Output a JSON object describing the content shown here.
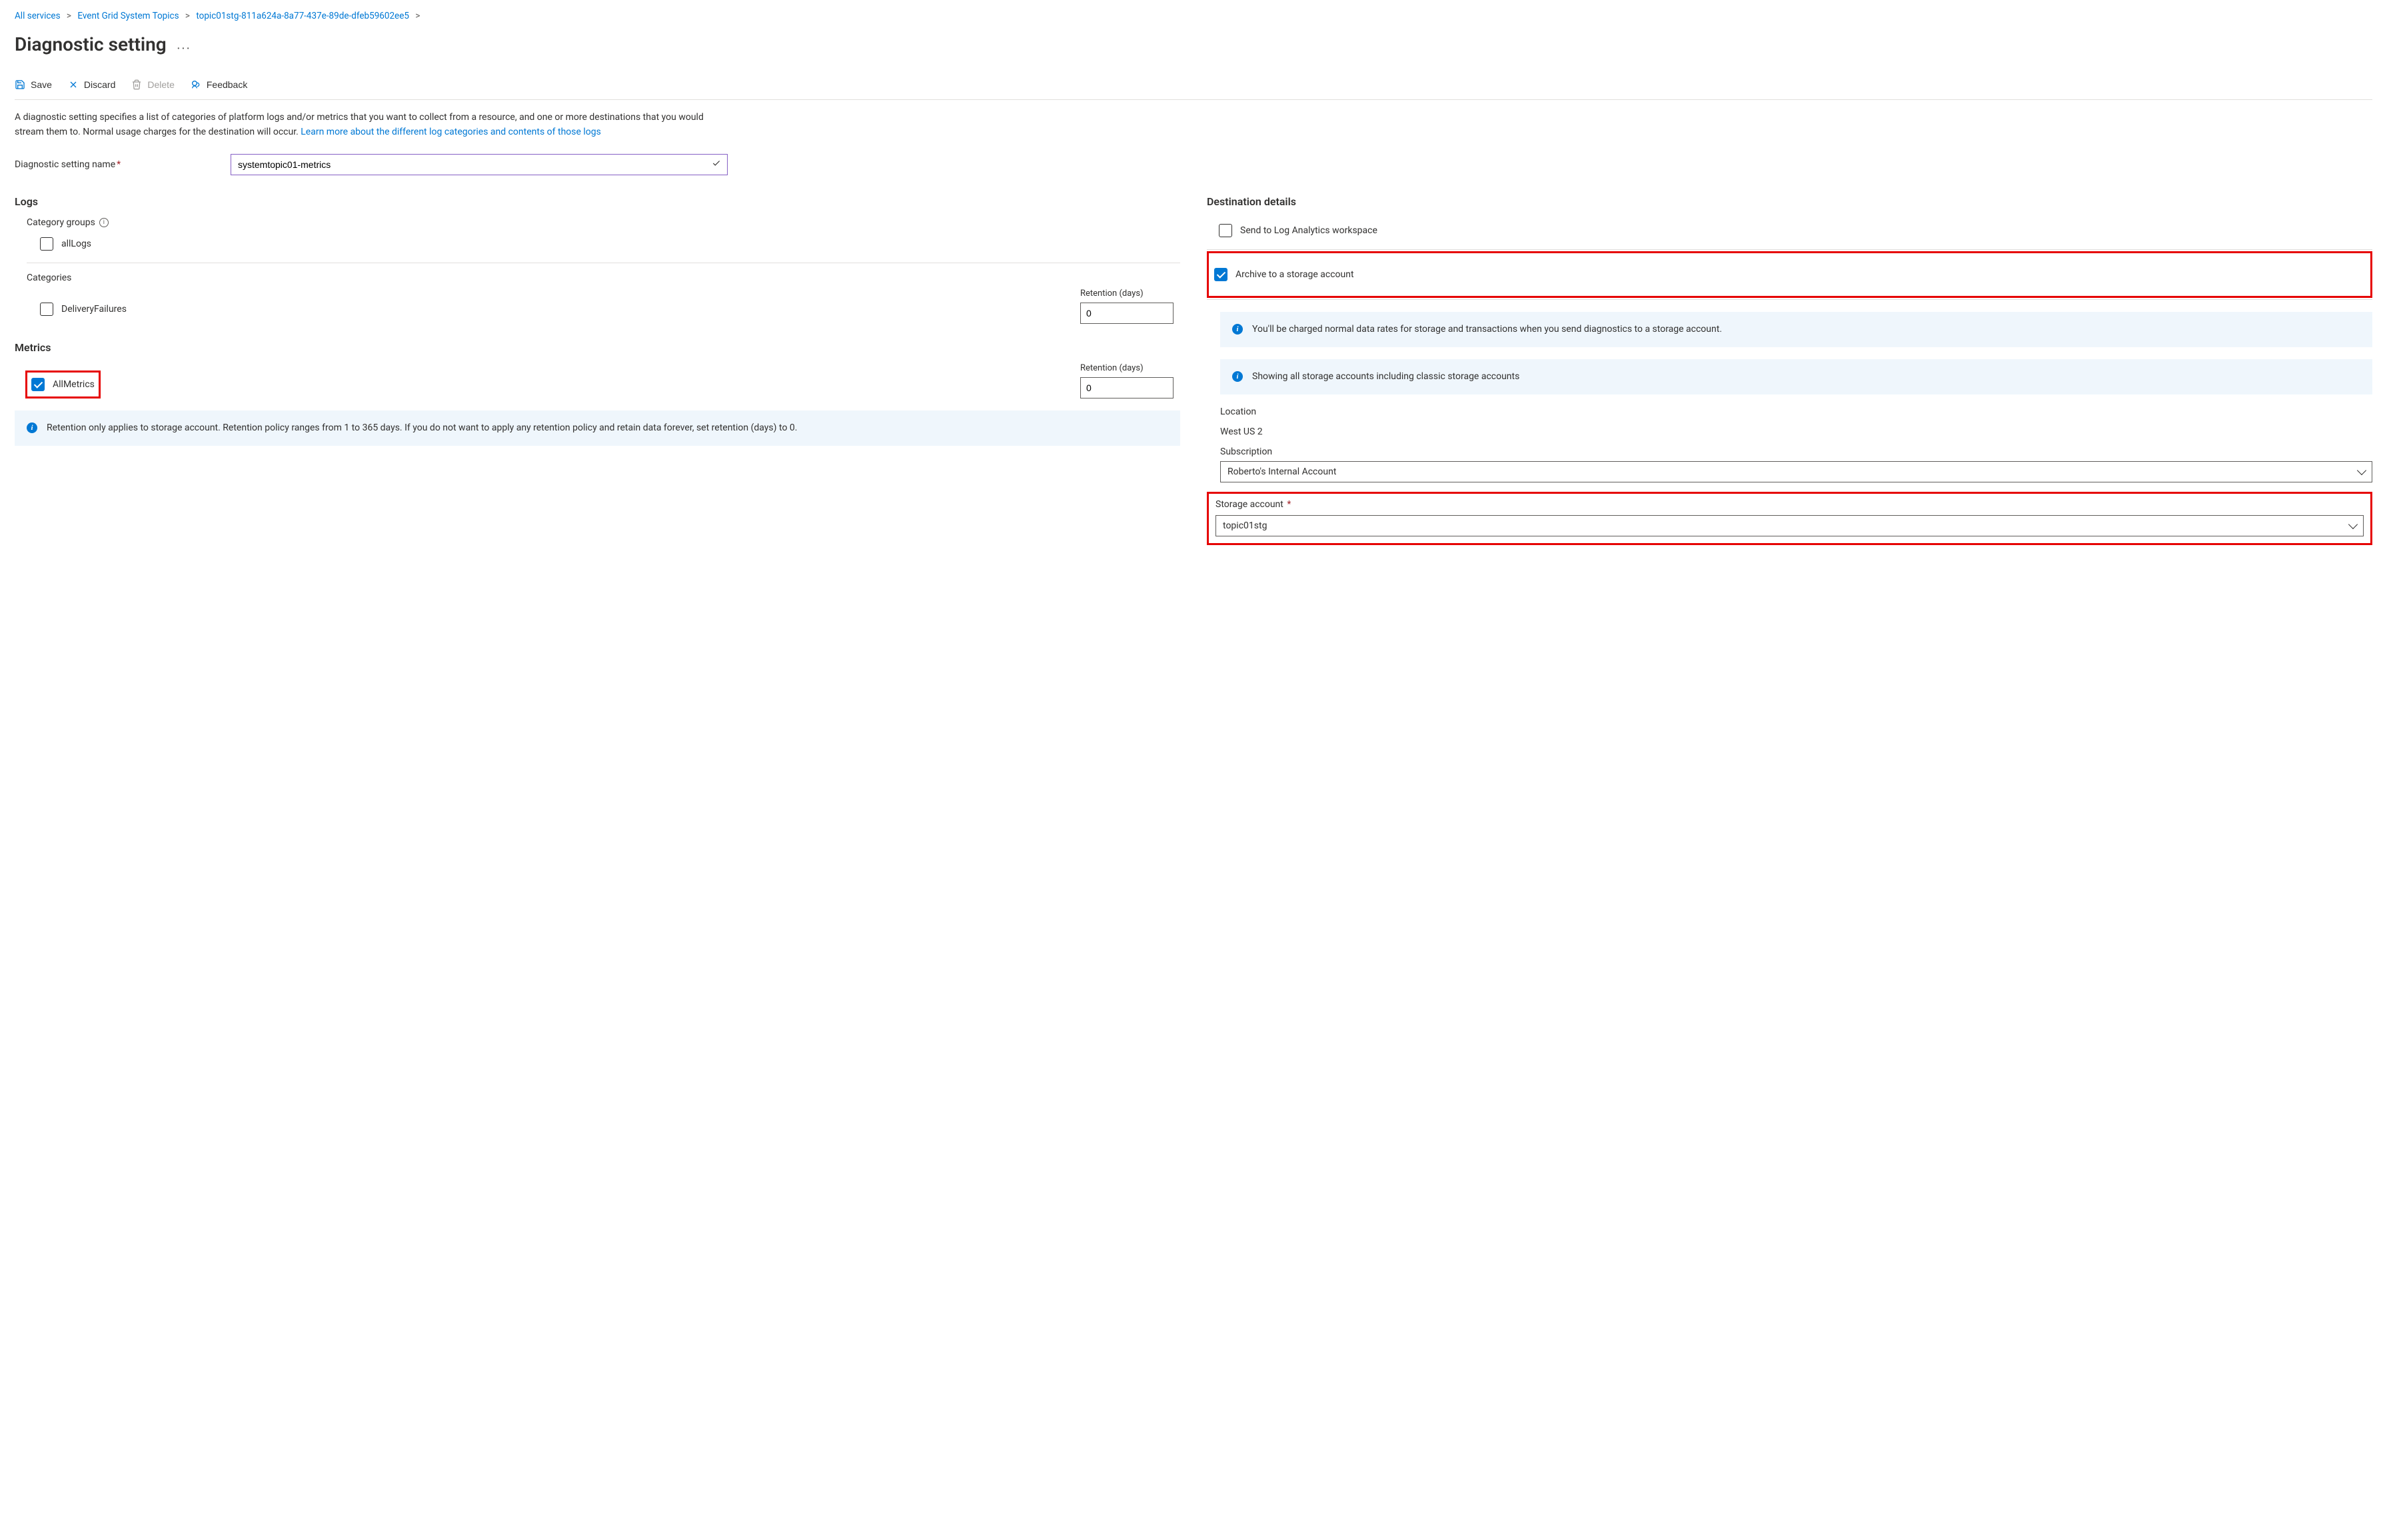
{
  "breadcrumb": {
    "items": [
      "All services",
      "Event Grid System Topics",
      "topic01stg-811a624a-8a77-437e-89de-dfeb59602ee5"
    ]
  },
  "title": "Diagnostic setting",
  "toolbar": {
    "save": "Save",
    "discard": "Discard",
    "delete": "Delete",
    "feedback": "Feedback"
  },
  "description": {
    "text": "A diagnostic setting specifies a list of categories of platform logs and/or metrics that you want to collect from a resource, and one or more destinations that you would stream them to. Normal usage charges for the destination will occur. ",
    "link": "Learn more about the different log categories and contents of those logs"
  },
  "nameField": {
    "label": "Diagnostic setting name",
    "value": "systemtopic01-metrics"
  },
  "logs": {
    "heading": "Logs",
    "categoryGroupsLabel": "Category groups",
    "allLogs": "allLogs",
    "categoriesLabel": "Categories",
    "deliveryFailures": "DeliveryFailures",
    "retentionLabel": "Retention (days)",
    "retentionValue": "0"
  },
  "metrics": {
    "heading": "Metrics",
    "allMetrics": "AllMetrics",
    "retentionLabel": "Retention (days)",
    "retentionValue": "0"
  },
  "retentionInfo": "Retention only applies to storage account. Retention policy ranges from 1 to 365 days. If you do not want to apply any retention policy and retain data forever, set retention (days) to 0.",
  "destinations": {
    "heading": "Destination details",
    "sendLA": "Send to Log Analytics workspace",
    "archive": "Archive to a storage account",
    "chargeInfo": "You'll be charged normal data rates for storage and transactions when you send diagnostics to a storage account.",
    "showingInfo": "Showing all storage accounts including classic storage accounts",
    "locationLabel": "Location",
    "locationValue": "West US 2",
    "subscriptionLabel": "Subscription",
    "subscriptionValue": "Roberto's Internal Account",
    "storageLabel": "Storage account",
    "storageValue": "topic01stg"
  }
}
